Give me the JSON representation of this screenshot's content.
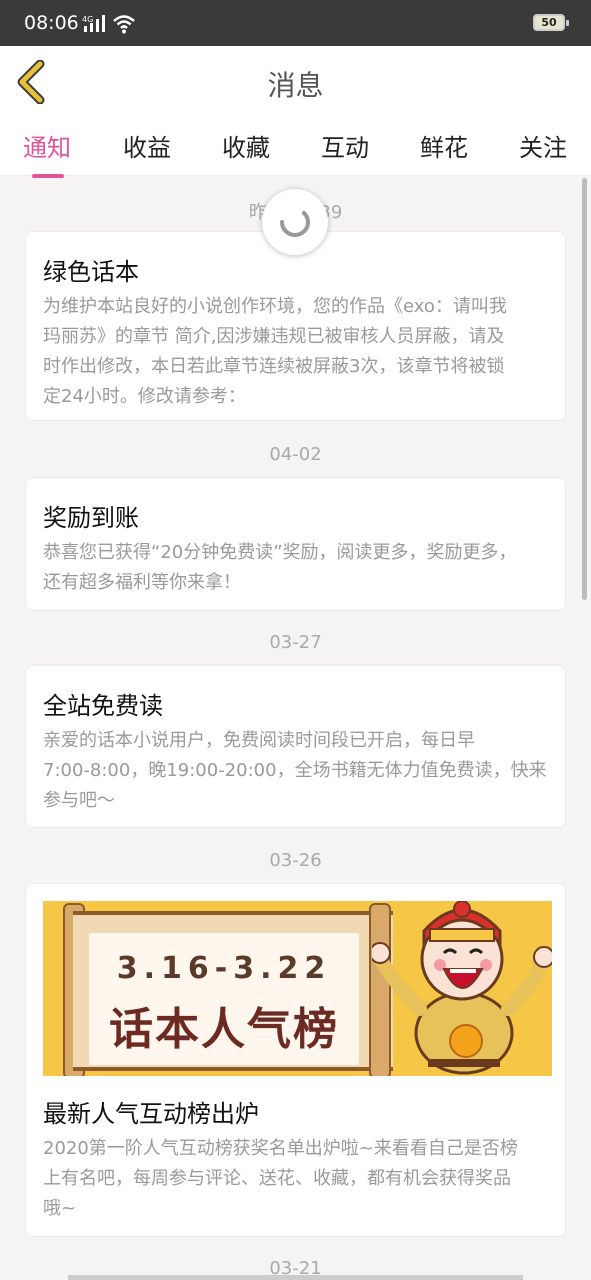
{
  "statusbar": {
    "time": "08:06",
    "signal_label": "4G",
    "battery": "50"
  },
  "header": {
    "title": "消息",
    "back_icon": "chevron-left-icon"
  },
  "tabs": [
    {
      "label": "通知",
      "active": true
    },
    {
      "label": "收益"
    },
    {
      "label": "收藏"
    },
    {
      "label": "互动"
    },
    {
      "label": "鲜花"
    },
    {
      "label": "关注"
    }
  ],
  "feed": [
    {
      "date": "昨天 13:39",
      "title": "绿色话本",
      "body_lines": [
        "为维护本站良好的小说创作环境，您的作品《exo：请叫我",
        "玛丽苏》的章节 简介,因涉嫌违规已被审核人员屏蔽，请及",
        "时作出修改，本日若此章节连续被屏蔽3次，该章节将被锁",
        "定24小时。修改请参考："
      ]
    },
    {
      "date": "04-02",
      "title": "奖励到账",
      "body_lines": [
        "恭喜您已获得“20分钟免费读”奖励，阅读更多，奖励更多，",
        "还有超多福利等你来拿！"
      ]
    },
    {
      "date": "03-27",
      "title": "全站免费读",
      "body_lines": [
        "亲爱的话本小说用户，免费阅读时间段已开启，每日早",
        "7:00-8:00，晚19:00-20:00，全场书籍无体力值免费读，快来",
        "参与吧～"
      ]
    },
    {
      "date": "03-26",
      "banner": {
        "dates": "3.16-3.22",
        "title": "话本人气榜"
      },
      "title": "最新人气互动榜出炉",
      "body_lines": [
        "2020第一阶人气互动榜获奖名单出炉啦~来看看自己是否榜",
        "上有名吧，每周参与评论、送花、收藏，都有机会获得奖品",
        "哦~"
      ]
    },
    {
      "date": "03-21"
    }
  ],
  "colors": {
    "accent": "#e0559a",
    "back_icon": "#e6c23a",
    "banner_bg": "#f6c646"
  }
}
